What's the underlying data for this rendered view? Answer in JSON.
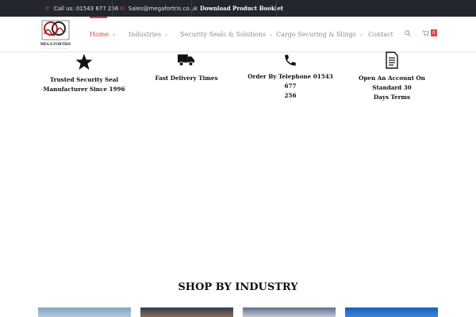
{
  "topbar": {
    "phone": "Call us: 01543 677 256",
    "email": "Sales@megafortris.co.uk",
    "booklet": "Download Product Booklet"
  },
  "logo": {
    "text": "MEGA FORTRIS",
    "icon": "logo-mark"
  },
  "nav": {
    "items": [
      {
        "label": "Home",
        "active": true,
        "has_dropdown": true
      },
      {
        "label": "Industries",
        "active": false,
        "has_dropdown": true
      },
      {
        "label": "Security Seals & Solutions",
        "active": false,
        "has_dropdown": true
      },
      {
        "label": "Cargo Securing & Slings",
        "active": false,
        "has_dropdown": true
      },
      {
        "label": "Contact",
        "active": false,
        "has_dropdown": false
      }
    ],
    "cart_count": "0",
    "accent_color": "#d8443e"
  },
  "features": [
    {
      "icon": "star-icon",
      "line1": "Trusted Security Seal",
      "line2": "Manufacturer Since 1996"
    },
    {
      "icon": "truck-icon",
      "line1": "Fast Delivery Times",
      "line2": ""
    },
    {
      "icon": "phone-icon",
      "line1": "Order By Telephone 01543 677",
      "line2": "256"
    },
    {
      "icon": "document-icon",
      "line1": "Open An Account On Standard 30",
      "line2": "Days Terms"
    }
  ],
  "shop": {
    "title": "SHOP BY INDUSTRY"
  }
}
